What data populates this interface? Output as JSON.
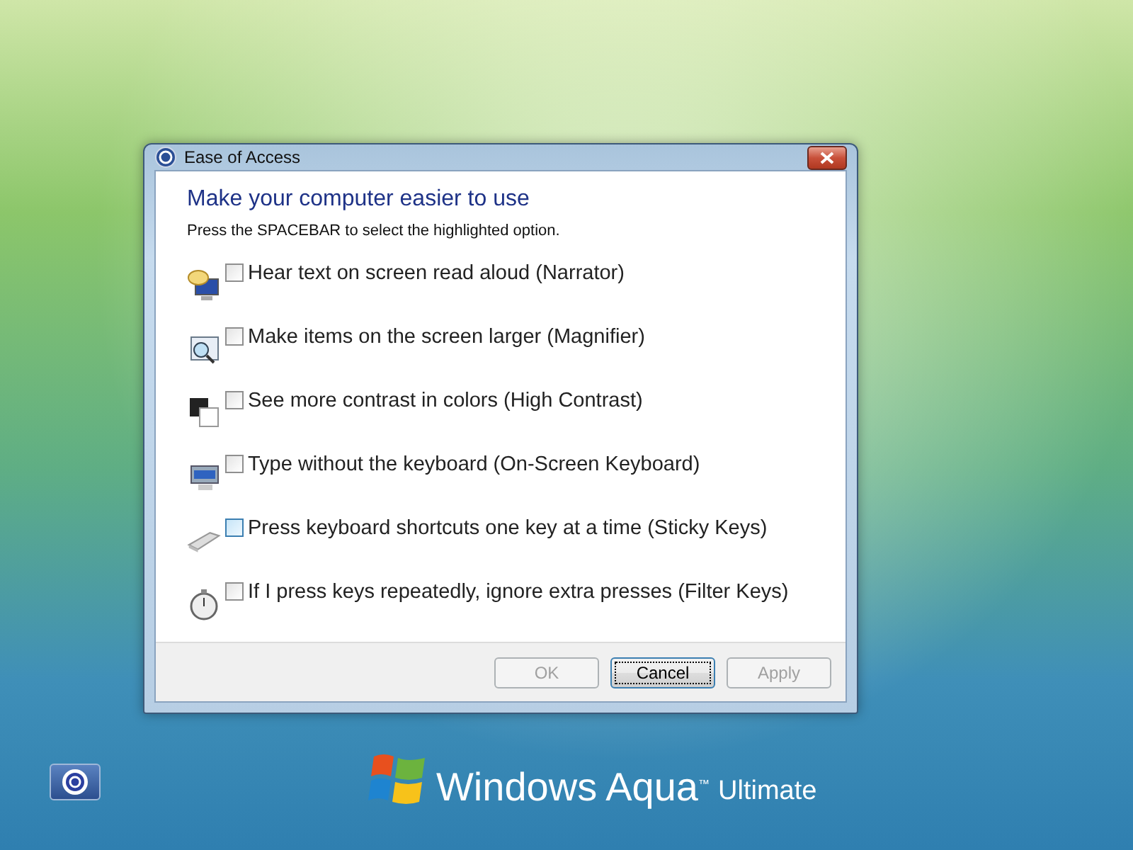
{
  "window": {
    "title": "Ease of Access"
  },
  "heading": "Make your computer easier to use",
  "instruction": "Press the SPACEBAR to select the highlighted option.",
  "options": [
    {
      "kind": "narrator",
      "label": "Hear text on screen read aloud (Narrator)",
      "checked": false,
      "highlighted": false
    },
    {
      "kind": "magnifier",
      "label": "Make items on the screen larger (Magnifier)",
      "checked": false,
      "highlighted": false
    },
    {
      "kind": "contrast",
      "label": "See more contrast in colors (High Contrast)",
      "checked": false,
      "highlighted": false
    },
    {
      "kind": "keyboard",
      "label": "Type without the keyboard (On-Screen Keyboard)",
      "checked": false,
      "highlighted": false
    },
    {
      "kind": "keys",
      "label": "Press keyboard shortcuts one key at a time (Sticky Keys)",
      "checked": false,
      "highlighted": true
    },
    {
      "kind": "timer",
      "label": "If I press keys repeatedly, ignore extra presses (Filter Keys)",
      "checked": false,
      "highlighted": false
    }
  ],
  "buttons": [
    {
      "label": "OK",
      "disabled": true,
      "focused": false
    },
    {
      "label": "Cancel",
      "disabled": false,
      "focused": true
    },
    {
      "label": "Apply",
      "disabled": true,
      "focused": false
    }
  ],
  "brand": {
    "name": "Windows",
    "edition": "Aqua",
    "trademark": "™",
    "tier": "Ultimate"
  }
}
